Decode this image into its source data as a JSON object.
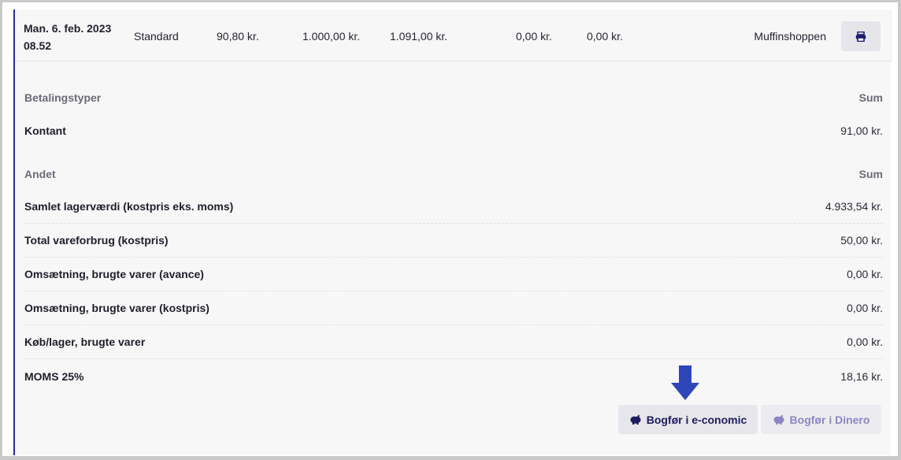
{
  "row": {
    "date_line1": "Man. 6. feb. 2023",
    "date_line2": "08.52",
    "type": "Standard",
    "col_a": "90,80 kr.",
    "col_b": "1.000,00 kr.",
    "col_c": "1.091,00 kr.",
    "col_d": "0,00 kr.",
    "col_e": "0,00 kr.",
    "shop": "Muffinshoppen",
    "print_icon": "printer-icon"
  },
  "payment": {
    "header_label": "Betalingstyper",
    "header_sum": "Sum",
    "rows": [
      {
        "label": "Kontant",
        "value": "91,00 kr."
      }
    ]
  },
  "other": {
    "header_label": "Andet",
    "header_sum": "Sum",
    "rows": [
      {
        "label": "Samlet lagerværdi (kostpris eks. moms)",
        "value": "4.933,54 kr."
      },
      {
        "label": "Total vareforbrug (kostpris)",
        "value": "50,00 kr."
      },
      {
        "label": "Omsætning, brugte varer (avance)",
        "value": "0,00 kr."
      },
      {
        "label": "Omsætning, brugte varer (kostpris)",
        "value": "0,00 kr."
      },
      {
        "label": "Køb/lager, brugte varer",
        "value": "0,00 kr."
      },
      {
        "label": "MOMS 25%",
        "value": "18,16 kr."
      }
    ]
  },
  "actions": {
    "economic_label": "Bogfør i e-conomic",
    "dinero_label": "Bogfør i Dinero",
    "icon": "piggy-bank-icon"
  },
  "colors": {
    "accent": "#2b2b9e",
    "arrow": "#2e46b8"
  }
}
